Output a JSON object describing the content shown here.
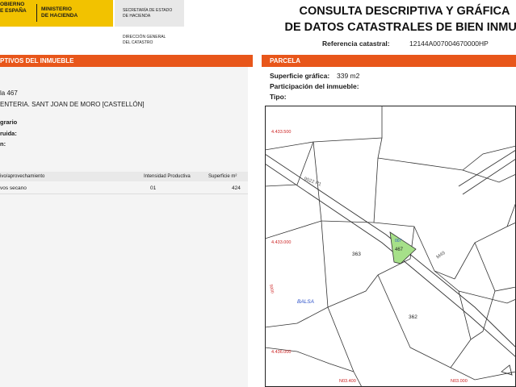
{
  "header": {
    "gov_line1": "OBIERNO",
    "gov_line2": "E ESPAÑA",
    "ministry_line1": "MINISTERIO",
    "ministry_line2": "DE HACIENDA",
    "secretaria_line1": "SECRETARÍA DE ESTADO",
    "secretaria_line2": "DE HACIENDA",
    "direccion_line1": "DIRECCIÓN GENERAL",
    "direccion_line2": "DEL CATASTRO",
    "title_line1": "CONSULTA DESCRIPTIVA Y GRÁFICA",
    "title_line2": "DE DATOS CATASTRALES DE BIEN INMUE",
    "ref_label": "Referencia catastral:",
    "ref_value": "12144A007004670000HP"
  },
  "left": {
    "bar_title": "PTIVOS DEL INMUEBLE",
    "location_line1": "la 467",
    "location_line2": "ENTERIA. SANT JOAN DE MORO [CASTELLÓN]",
    "label_clase": "grario",
    "label_uso": "ruida:",
    "label_superficie": "n:",
    "label_ano": "",
    "table": {
      "headers": [
        "ivo/aprovechamiento",
        "Intensidad Productiva",
        "Superficie m²"
      ],
      "rows": [
        {
          "cultivo": "vos secano",
          "intensidad": "01",
          "superficie": "424"
        }
      ]
    }
  },
  "right": {
    "bar_title": "PARCELA",
    "sup_grafica_label": "Superficie gráfica:",
    "sup_grafica_value": "339 m2",
    "participacion_label": "Participación del inmueble:",
    "tipo_label": "Tipo:"
  },
  "map": {
    "coord_top": "4.433.500",
    "coord_mid": "4.433.000",
    "coord_bottom": "4.436.000",
    "road_label_top": "9022 P1",
    "road_label_right": "M49",
    "parcel_highlight_label": "467",
    "parcel_highlight_small": "007",
    "parcel_363": "363",
    "parcel_362": "362",
    "balsa_label": "BALSA",
    "vert_label": "5000",
    "bottom_left_coord": "N03.400",
    "bottom_right_coord": "N03.000",
    "highlight_color": "#a6e089",
    "road_color": "#333333"
  }
}
